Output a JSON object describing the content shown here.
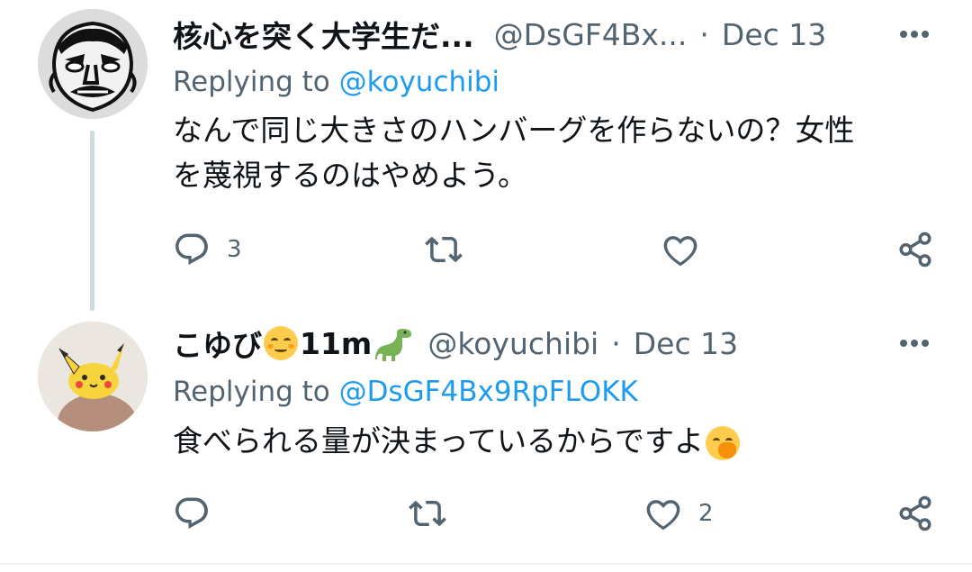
{
  "tweets": [
    {
      "author_name": "核心を突く大学生だ...",
      "handle": "@DsGF4Bx...",
      "separator": "·",
      "date": "Dec 13",
      "replying_prefix": "Replying to",
      "replying_to": "@koyuchibi",
      "body_line1": "なんで同じ大きさのハンバーグを作らないの？女性",
      "body_line2": "を蔑視するのはやめよう。",
      "avatar_icon": "manga-face-avatar",
      "actions": {
        "reply_count": "3",
        "retweet_count": "",
        "like_count": ""
      }
    },
    {
      "author_name": "こゆび",
      "author_name_suffix": "11m",
      "name_emoji_1": "smiling-face-emoji",
      "name_emoji_2": "dinosaur-emoji",
      "handle": "@koyuchibi",
      "separator": "·",
      "date": "Dec 13",
      "replying_prefix": "Replying to",
      "replying_to": "@DsGF4Bx9RpFLOKK",
      "body": "食べられる量が決まっているからですよ",
      "body_emoji": "hand-over-mouth-emoji",
      "avatar_icon": "pikachu-plush-avatar",
      "actions": {
        "reply_count": "",
        "retweet_count": "",
        "like_count": "2"
      }
    }
  ],
  "colors": {
    "text": "#0f1419",
    "secondary": "#536471",
    "link": "#1d9bf0",
    "thread_line": "#cfd9de"
  }
}
